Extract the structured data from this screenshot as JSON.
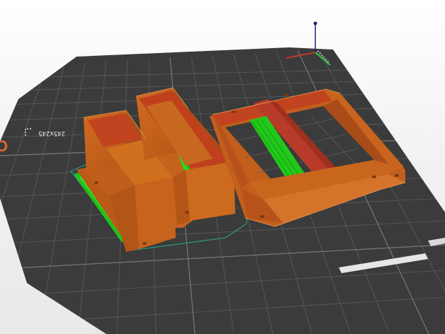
{
  "viewport": {
    "bed_size_label": "245x245",
    "logo_glyph": "O",
    "colors": {
      "bed": "#3a3a3a",
      "grid": "#5a5a5a",
      "part_orange": "#c8641e",
      "part_red": "#b83a28",
      "support_green": "#22d31a",
      "skirt_teal": "#1f8f74",
      "axis_x": "#c0392b",
      "axis_y": "#2ecc40",
      "axis_z": "#1a237e"
    },
    "icons": [
      "axis-gizmo-icon"
    ]
  }
}
